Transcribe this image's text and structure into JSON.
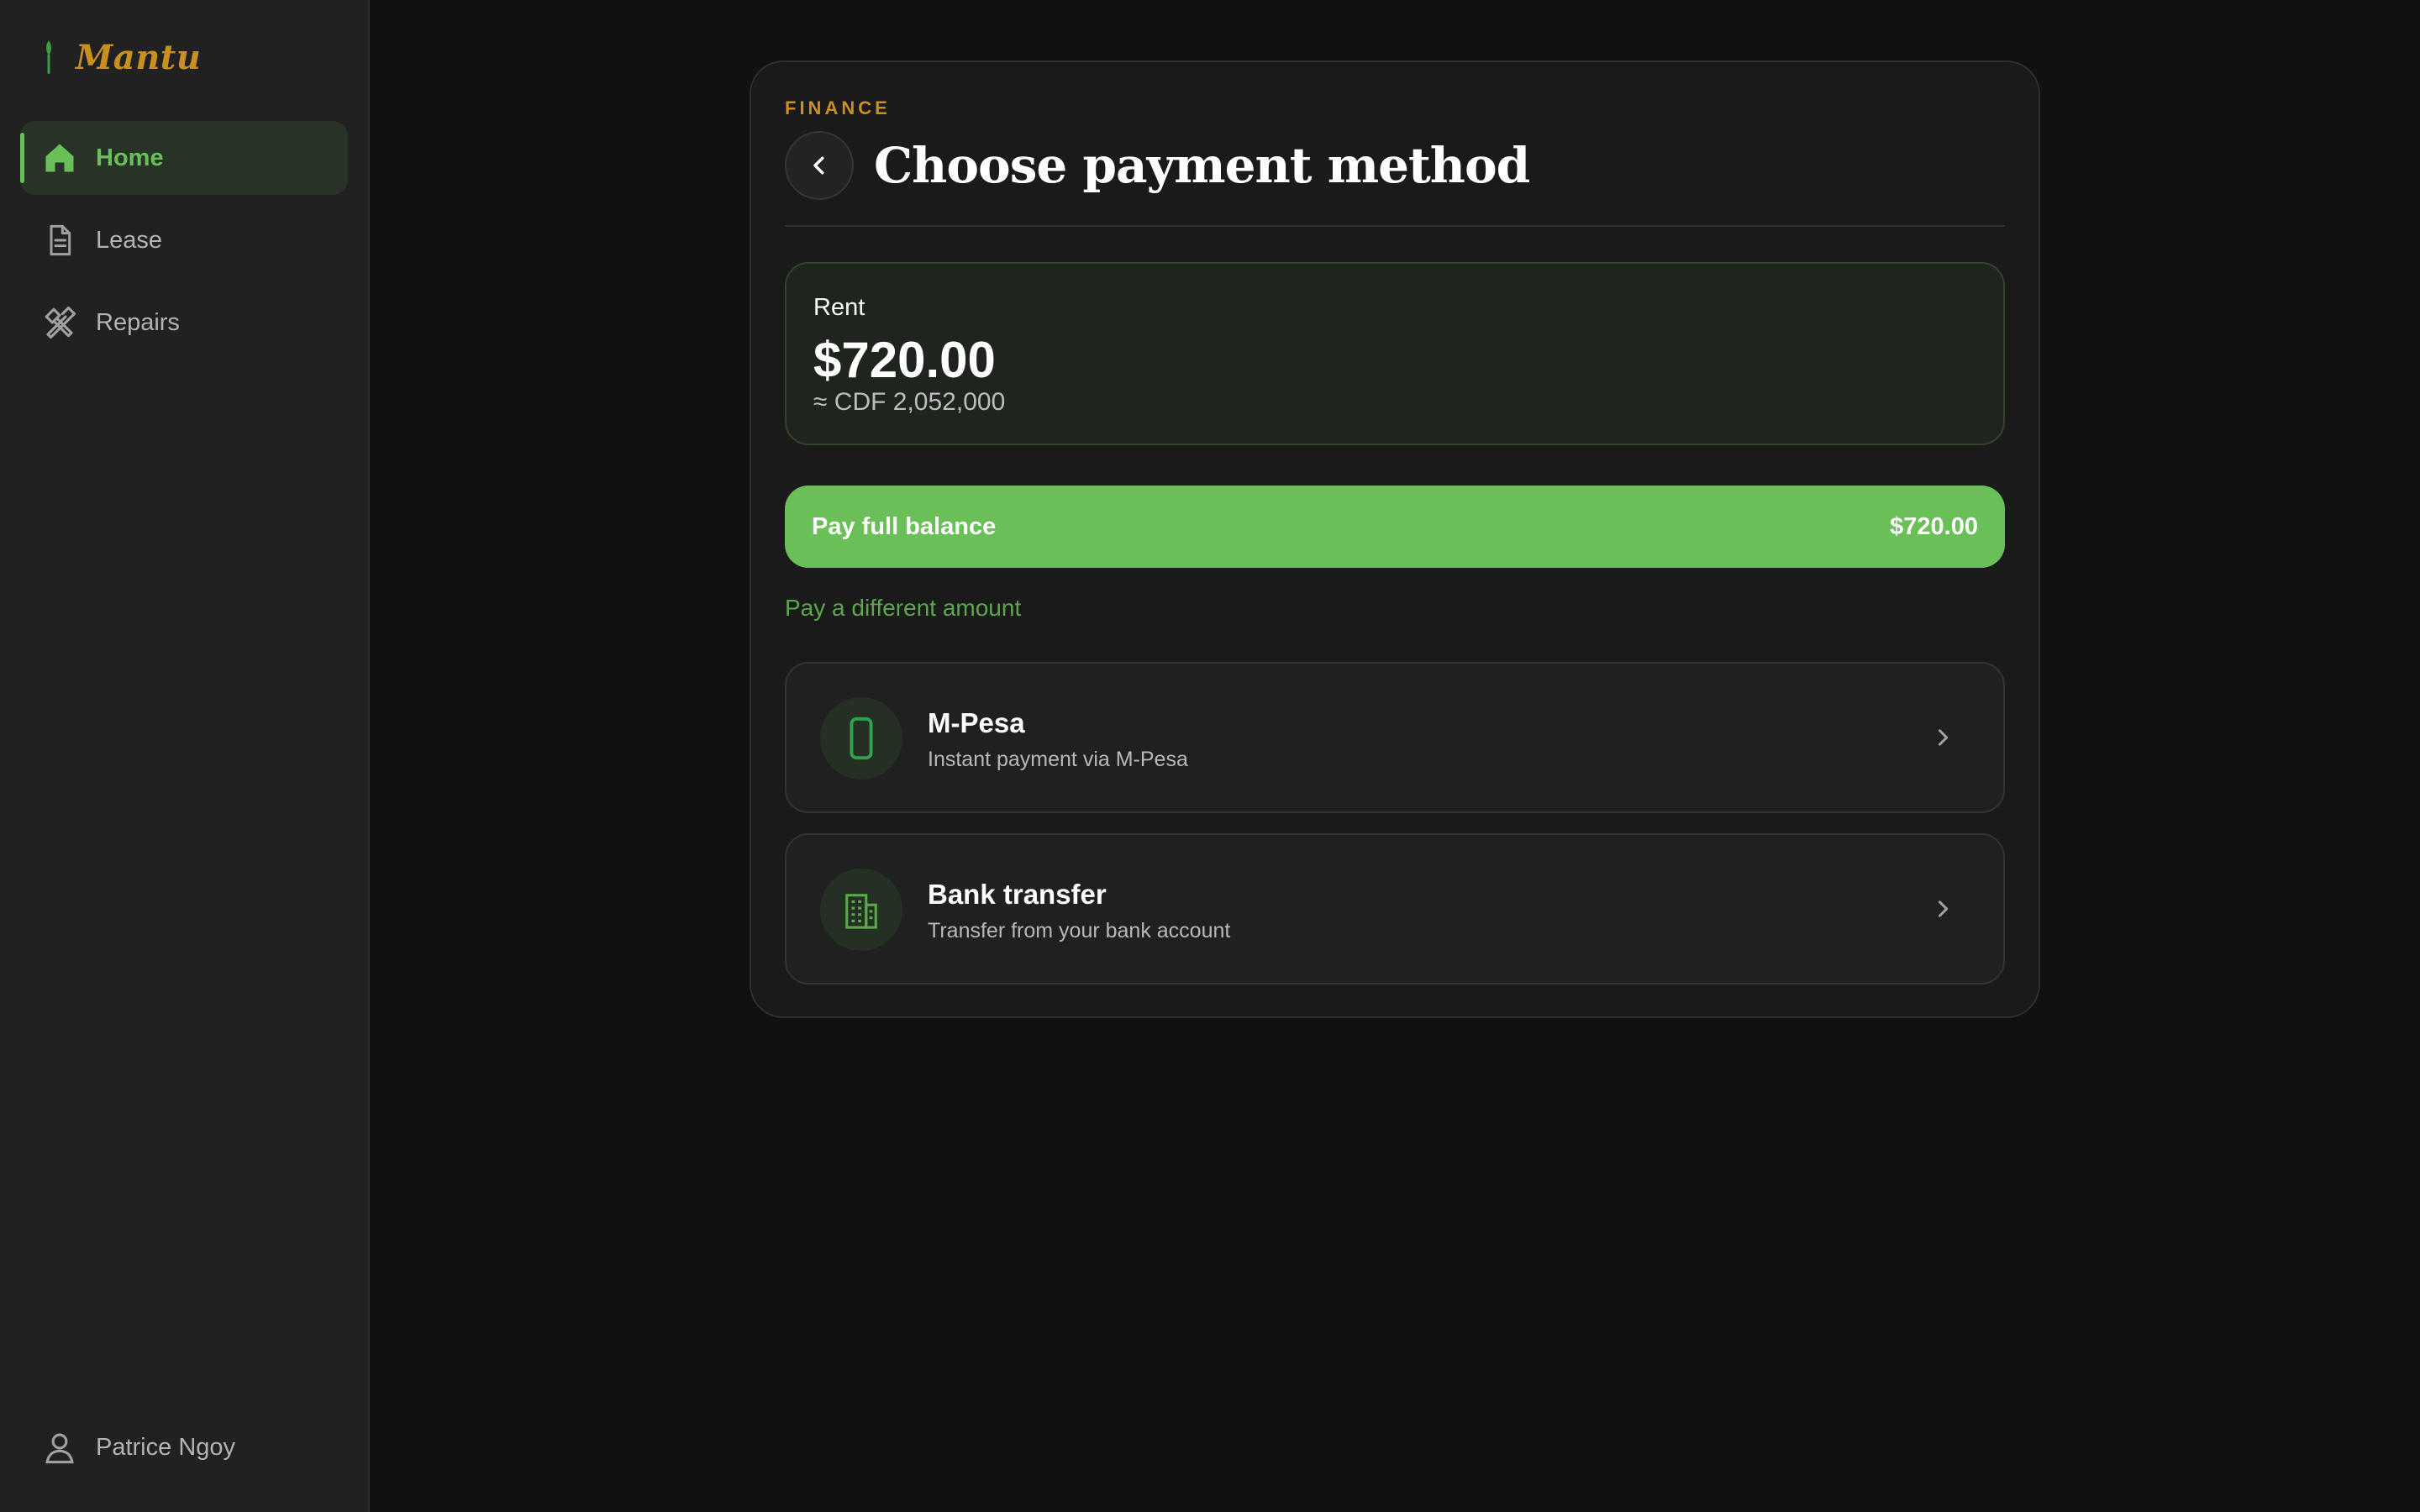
{
  "app": {
    "brand_name": "Mantu",
    "accent_color": "#6abf59",
    "brand_color": "#c8901e"
  },
  "sidebar": {
    "items": [
      {
        "label": "Home",
        "icon": "home-icon",
        "active": true
      },
      {
        "label": "Lease",
        "icon": "document-icon",
        "active": false
      },
      {
        "label": "Repairs",
        "icon": "tools-icon",
        "active": false
      }
    ],
    "user": {
      "name": "Patrice Ngoy",
      "icon": "user-icon"
    }
  },
  "page": {
    "eyebrow": "FINANCE",
    "title": "Choose payment method",
    "back_icon": "chevron-left-icon"
  },
  "amount": {
    "label": "Rent",
    "value": "$720.00",
    "converted": "≈ CDF 2,052,000"
  },
  "pay_full": {
    "label": "Pay full balance",
    "amount": "$720.00"
  },
  "pay_different": {
    "label": "Pay a different amount"
  },
  "methods": [
    {
      "title": "M-Pesa",
      "subtitle": "Instant payment via M-Pesa",
      "icon": "phone-icon"
    },
    {
      "title": "Bank transfer",
      "subtitle": "Transfer from your bank account",
      "icon": "bank-building-icon"
    }
  ]
}
